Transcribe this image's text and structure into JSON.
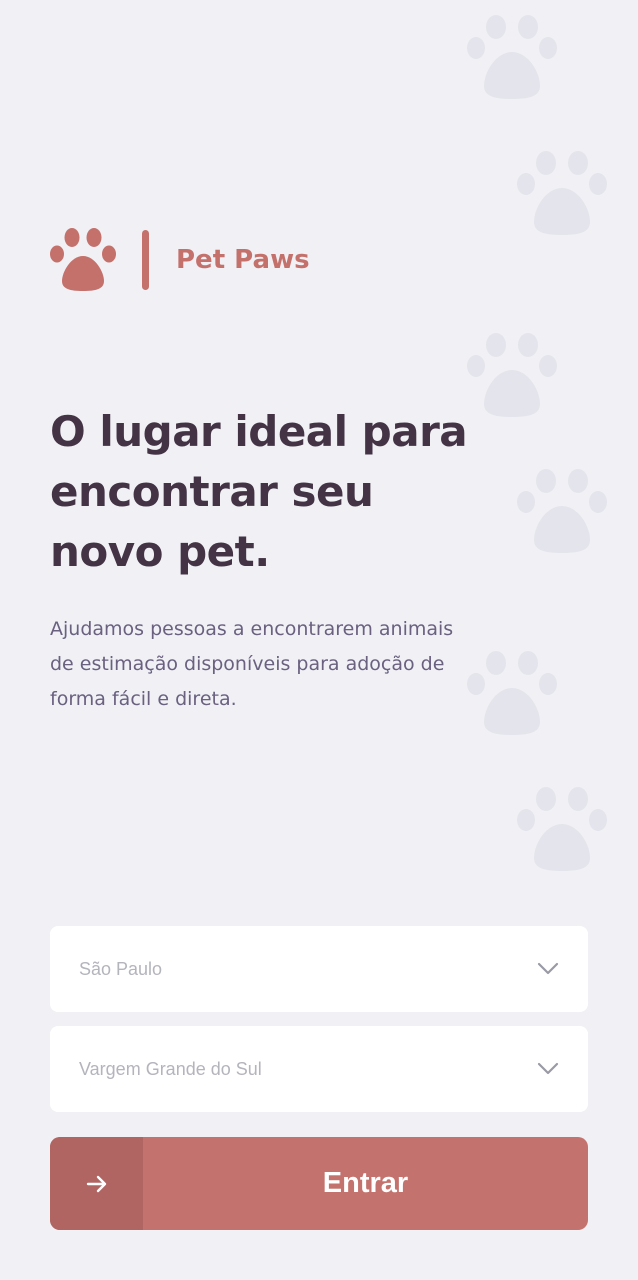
{
  "brand": {
    "name": "Pet Paws",
    "logo_icon": "paw-icon"
  },
  "hero": {
    "headline": "O lugar ideal para encontrar seu novo pet.",
    "subtitle": "Ajudamos pessoas a encontrarem animais de estimação disponíveis para adoção de forma fácil e direta."
  },
  "form": {
    "state_select": {
      "value": "São Paulo",
      "icon": "chevron-down-icon"
    },
    "city_select": {
      "value": "Vargem Grande do Sul",
      "icon": "chevron-down-icon"
    },
    "enter_button": {
      "label": "Entrar",
      "icon": "arrow-right-icon"
    }
  },
  "colors": {
    "background": "#f0f0f5",
    "accent": "#c4716c",
    "accent_dark": "#b06562",
    "headline": "#433344",
    "body_text": "#6a6180",
    "placeholder_text": "#b4b4bd"
  }
}
